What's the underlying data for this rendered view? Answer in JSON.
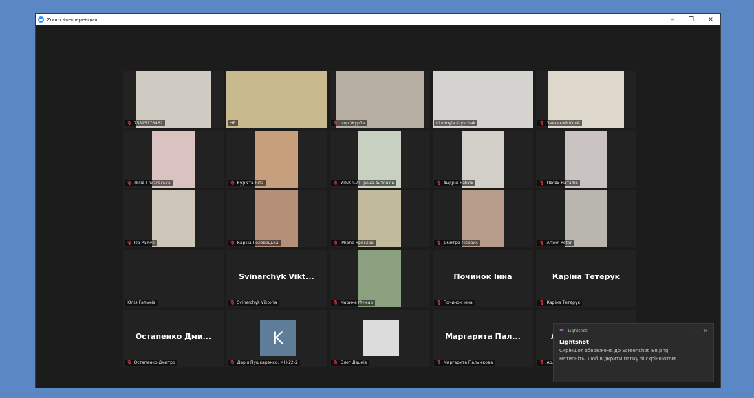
{
  "window": {
    "title": "Zoom Конференция",
    "controls": [
      "–",
      "❐",
      "✕"
    ]
  },
  "participants": [
    {
      "label": "758951764​62",
      "kind": "video",
      "bg": "#cfcac2",
      "mic_muted": true
    },
    {
      "label": "НБ",
      "kind": "video",
      "bg": "#c9b98f",
      "mic_muted": false,
      "active": true
    },
    {
      "label": "Ігор Журба",
      "kind": "video",
      "bg": "#b7b0a2",
      "mic_muted": true
    },
    {
      "label": "Liudmyla Kryvchak",
      "kind": "video",
      "bg": "#d5d3cf",
      "mic_muted": false
    },
    {
      "label": "Земський Юрій",
      "kind": "video",
      "bg": "#ddd7cc",
      "mic_muted": true
    },
    {
      "label": "Лілія Гризовська",
      "kind": "video",
      "bg": "#d9c2c0",
      "mic_muted": true
    },
    {
      "label": "Кур'ята Віта",
      "kind": "video",
      "bg": "#c79f7d",
      "mic_muted": true
    },
    {
      "label": "УТБКЛ-21 Ірена Антонюк",
      "kind": "video",
      "bg": "#c8d0c2",
      "mic_muted": true
    },
    {
      "label": "Андрій Бабюк",
      "kind": "video",
      "bg": "#d2cfc8",
      "mic_muted": true
    },
    {
      "label": "Овсяк Наталія",
      "kind": "video",
      "bg": "#c9c4c2",
      "mic_muted": true
    },
    {
      "label": "Illa Palhyk",
      "kind": "video",
      "bg": "#cdc6b8",
      "mic_muted": true
    },
    {
      "label": "Каріна Головецька",
      "kind": "video",
      "bg": "#b58f78",
      "mic_muted": true
    },
    {
      "label": "iPhone Ярослав",
      "kind": "video",
      "bg": "#c1ba9c",
      "mic_muted": true
    },
    {
      "label": "Дмитро Лісовик",
      "kind": "video",
      "bg": "#b79c8b",
      "mic_muted": true
    },
    {
      "label": "Artem Rotar",
      "kind": "video",
      "bg": "#b8b6ad",
      "mic_muted": true
    },
    {
      "label": "Юлія Гальміз",
      "kind": "empty",
      "mic_muted": false
    },
    {
      "label": "Svinarchyk Viktoria",
      "kind": "name",
      "big": "Svinarchyk  Vikt...",
      "mic_muted": true
    },
    {
      "label": "Марина Мужар",
      "kind": "video",
      "bg": "#8aa07f",
      "mic_muted": true
    },
    {
      "label": "Починок Інна",
      "kind": "name",
      "big": "Починок Інна",
      "mic_muted": true
    },
    {
      "label": "Каріна Тетерук",
      "kind": "name",
      "big": "Каріна Тетерук",
      "mic_muted": true
    },
    {
      "label": "Остапенко Дмитро",
      "kind": "name",
      "big": "Остапенко  Дми...",
      "mic_muted": true
    },
    {
      "label": "Дарія Пушкаренко. МН-22-2",
      "kind": "avatar",
      "initial": "K",
      "mic_muted": true
    },
    {
      "label": "Олег Дацків",
      "kind": "blank",
      "mic_muted": true
    },
    {
      "label": "Маргарита Пальчікова",
      "kind": "name",
      "big": "Маргарита  Пал...",
      "mic_muted": true
    },
    {
      "label": "Ар...",
      "kind": "name",
      "big": "Артем  Богайчук",
      "mic_muted": true
    }
  ],
  "notification": {
    "app": "Lightshot",
    "title": "Lightshot",
    "line1": "Скріншот збережено до Screenshot_88.png.",
    "line2": "Натисніть, щоб відкрити папку зі скріншотом.",
    "minimize": "—",
    "close": "✕"
  },
  "colors": {
    "desktop": "#5b87c4",
    "stage": "#1c1c1c",
    "active_border": "#d8e44a",
    "muted_mic": "#e0393e"
  }
}
